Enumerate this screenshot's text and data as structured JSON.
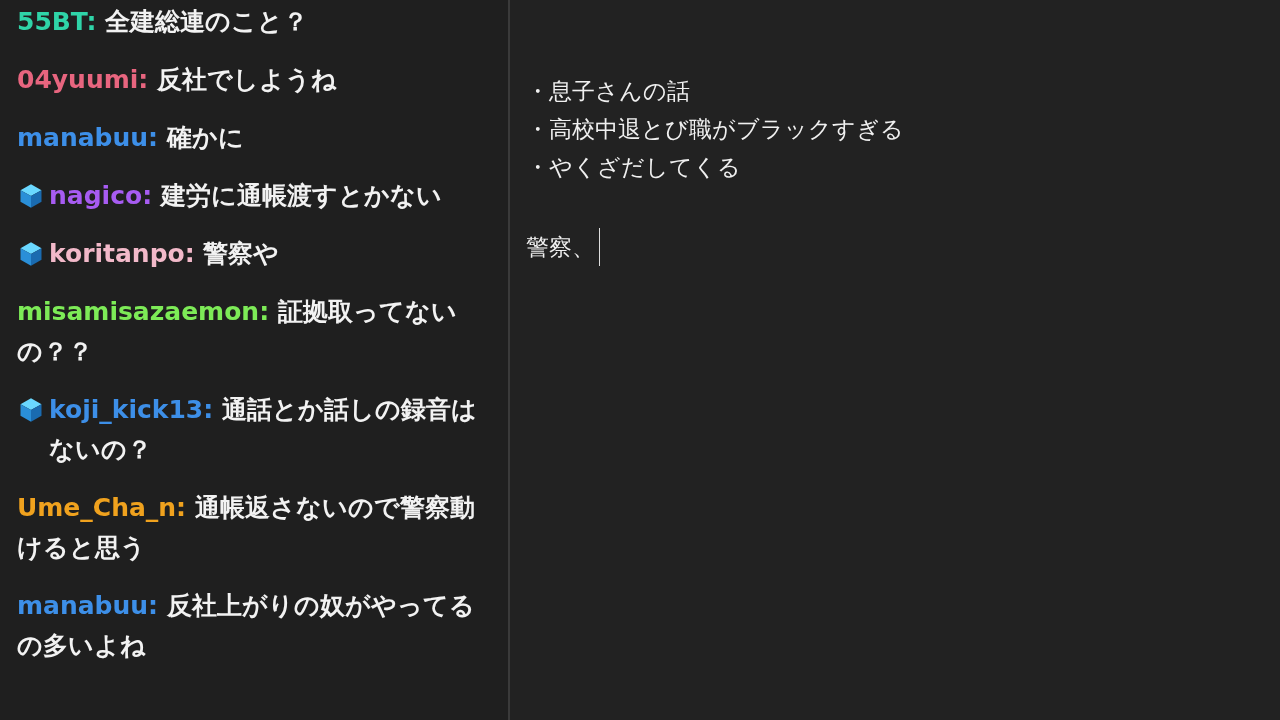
{
  "chat": {
    "messages": [
      {
        "user": "55BT:",
        "color": "#2fd4a8",
        "badge": false,
        "text": "全建総連のこと？"
      },
      {
        "user": "04yuumi:",
        "color": "#e8657f",
        "badge": false,
        "text": "反社でしようね"
      },
      {
        "user": "manabuu:",
        "color": "#3d8fe8",
        "badge": false,
        "text": "確かに"
      },
      {
        "user": "nagico:",
        "color": "#a75cf2",
        "badge": true,
        "text": "建労に通帳渡すとかない"
      },
      {
        "user": "koritanpo:",
        "color": "#f2b9c9",
        "badge": true,
        "text": "警察や"
      },
      {
        "user": "misamisazaemon:",
        "color": "#7deb57",
        "badge": false,
        "text": "証拠取ってないの？？"
      },
      {
        "user": "koji_kick13:",
        "color": "#3d8fe8",
        "badge": true,
        "text": "通話とか話しの録音はないの？"
      },
      {
        "user": "Ume_Cha_n:",
        "color": "#f0a21e",
        "badge": false,
        "text": "通帳返さないので警察動けると思う"
      },
      {
        "user": "manabuu:",
        "color": "#3d8fe8",
        "badge": false,
        "text": "反社上がりの奴がやってるの多いよね"
      }
    ]
  },
  "notes": {
    "lines": [
      "・息子さんの話",
      "・高校中退とび職がブラックすぎる",
      "・やくざだしてくる"
    ],
    "typing": "警察、"
  }
}
